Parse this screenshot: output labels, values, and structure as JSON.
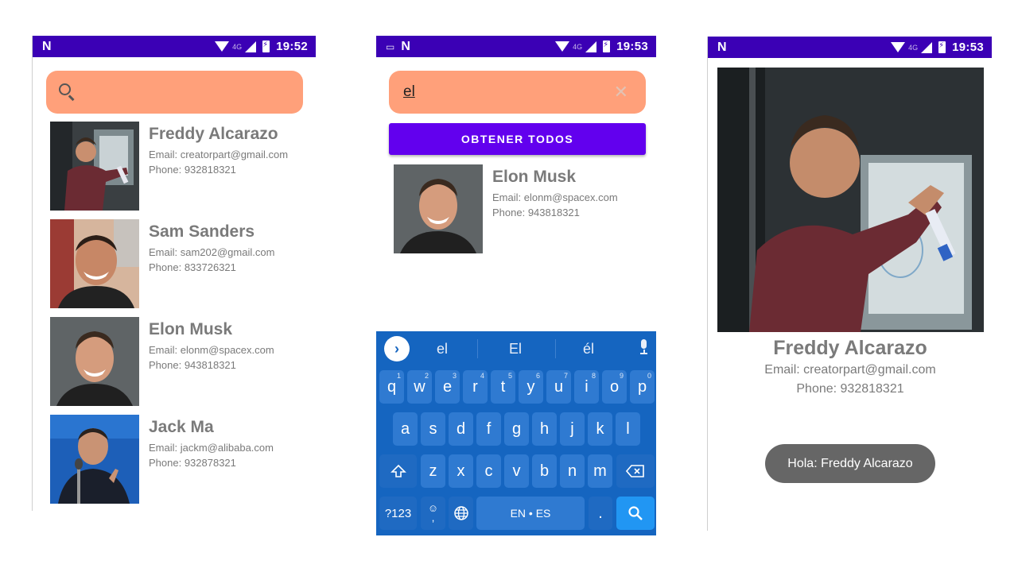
{
  "status_bars": [
    {
      "time": "19:52",
      "network": "4G"
    },
    {
      "time": "19:53",
      "network": "4G"
    },
    {
      "time": "19:53",
      "network": "4G"
    }
  ],
  "screen_list": {
    "search_value": "",
    "contacts": [
      {
        "name": "Freddy Alcarazo",
        "email": "Email: creatorpart@gmail.com",
        "phone": "Phone: 932818321"
      },
      {
        "name": "Sam Sanders",
        "email": "Email: sam202@gmail.com",
        "phone": "Phone: 833726321"
      },
      {
        "name": "Elon Musk",
        "email": "Email: elonm@spacex.com",
        "phone": "Phone: 943818321"
      },
      {
        "name": "Jack Ma",
        "email": "Email: jackm@alibaba.com",
        "phone": "Phone: 932878321"
      }
    ]
  },
  "screen_search": {
    "search_value": "el",
    "get_all_label": "OBTENER TODOS",
    "results": [
      {
        "name": "Elon Musk",
        "email": "Email: elonm@spacex.com",
        "phone": "Phone: 943818321"
      }
    ],
    "keyboard": {
      "suggestions": [
        "el",
        "El",
        "él"
      ],
      "row1": [
        "q",
        "w",
        "e",
        "r",
        "t",
        "y",
        "u",
        "i",
        "o",
        "p"
      ],
      "row1_digits": [
        "1",
        "2",
        "3",
        "4",
        "5",
        "6",
        "7",
        "8",
        "9",
        "0"
      ],
      "row2": [
        "a",
        "s",
        "d",
        "f",
        "g",
        "h",
        "j",
        "k",
        "l"
      ],
      "row3": [
        "z",
        "x",
        "c",
        "v",
        "b",
        "n",
        "m"
      ],
      "symbols_label": "?123",
      "emoji_comma": "☺\n,",
      "space_label": "EN • ES",
      "period_label": "."
    }
  },
  "screen_detail": {
    "name": "Freddy Alcarazo",
    "email": "Email: creatorpart@gmail.com",
    "phone": "Phone: 932818321",
    "toast": "Hola: Freddy Alcarazo"
  },
  "colors": {
    "status_bar": "#3b00b5",
    "search_bg": "#ffa07a",
    "primary_button": "#6200ee",
    "keyboard_bg": "#1565c0",
    "text_gray": "#7a7a7a"
  }
}
